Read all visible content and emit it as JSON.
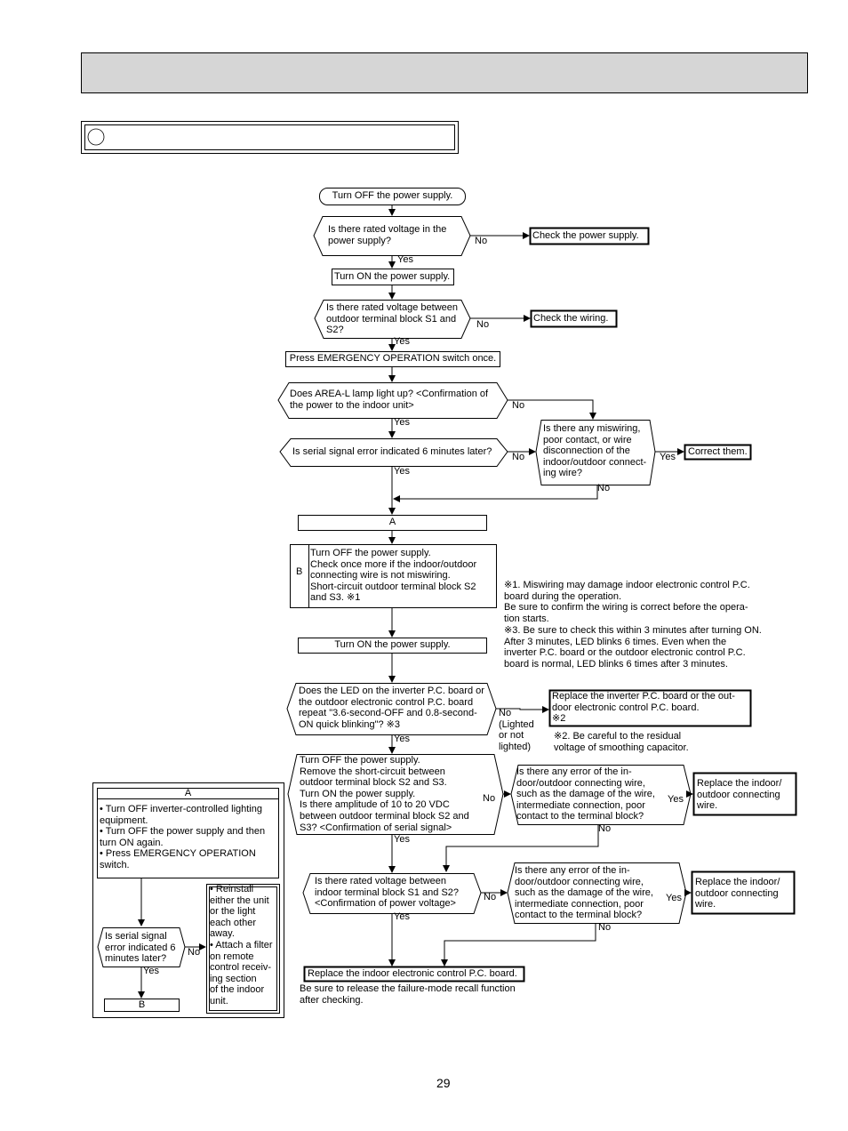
{
  "flow": {
    "start": "Turn OFF the power supply.",
    "q1": "Is there rated voltage in the\npower supply?",
    "a1_no": "Check the power supply.",
    "turn_on": "Turn ON the power supply.",
    "q2": "Is there rated voltage between\noutdoor terminal block S1 and\nS2?",
    "a2_no": "Check the wiring.",
    "press": "Press EMERGENCY OPERATION switch once.",
    "q3": "Does AREA-L lamp light up? <Confirmation of\nthe power to the indoor unit>",
    "q4": "Is serial signal error indicated 6 minutes later?",
    "q5": "Is there any miswiring,\npoor contact, or wire\ndisconnection of the\nindoor/outdoor connect-\ning wire?",
    "a5_yes": "Correct them.",
    "box_a": "A",
    "box_b_letter": "B",
    "box_b": "Turn OFF the power supply.\nCheck once more if the indoor/outdoor\nconnecting wire is not miswiring.\nShort-circuit outdoor terminal block S2\nand S3. ※1",
    "turn_on2": "Turn ON the power supply.",
    "q6": "Does the LED on the inverter P.C. board or\nthe outdoor electronic control P.C. board\nrepeat \"3.6-second-OFF and 0.8-second-\nON quick blinking\"?  ※3",
    "q6_no": "No\n(Lighted\nor not\nlighted)",
    "a6_no": "Replace the inverter P.C. board or the out-\ndoor electronic control P.C. board.\n※2",
    "q7": "Turn OFF the power supply.\nRemove the short-circuit between\noutdoor terminal block S2 and S3.\nTurn ON the power supply.\nIs there amplitude of 10 to 20 VDC\nbetween outdoor terminal block S2 and\nS3?  <Confirmation of serial signal>",
    "q8": "Is there any error of the in-\ndoor/outdoor connecting wire,\nsuch as the damage of the wire,\nintermediate connection, poor\ncontact to the terminal block?",
    "a8_yes": "Replace the indoor/\noutdoor connecting\nwire.",
    "q9": "Is there rated voltage between\nindoor terminal block S1 and S2?\n<Confirmation of power voltage>",
    "q10": "Is there any error of the in-\ndoor/outdoor connecting wire,\nsuch as the damage of the wire,\nintermediate connection, poor\ncontact to the terminal block?",
    "a10_yes": "Replace the indoor/\noutdoor connecting\nwire.",
    "final": "Replace the indoor electronic control P.C. board.",
    "final_note": "Be sure to release the failure-mode recall function\nafter checking.",
    "yes": "Yes",
    "no": "No"
  },
  "notes": {
    "n1": "※1. Miswiring may damage indoor electronic control P.C.\n       board during the operation.\n       Be sure to confirm the wiring is correct before the opera-\n       tion starts.",
    "n3": "※3. Be sure to check this within 3 minutes after turning ON.\n       After 3 minutes, LED blinks 6 times. Even when the\n       inverter P.C. board or the outdoor electronic control P.C.\n       board is normal, LED blinks 6 times after 3 minutes.",
    "n2": "※2. Be careful to the residual\n       voltage of smoothing capacitor."
  },
  "side": {
    "a_title": "A",
    "a_items": "• Turn OFF inverter-controlled lighting\n   equipment.\n• Turn OFF the power supply and then\n   turn ON again.\n• Press EMERGENCY OPERATION\n   switch.",
    "q": "Is serial signal\nerror indicated 6\nminutes later?",
    "no_box": "• Reinstall\n   either the unit\n   or the light\n   each other\n   away.\n• Attach a filter\n   on remote\n   control receiv-\n   ing section\n   of the indoor\n   unit.",
    "b": "B"
  },
  "page_number": "29",
  "colors": {
    "header_fill": "#d6d6d6"
  }
}
